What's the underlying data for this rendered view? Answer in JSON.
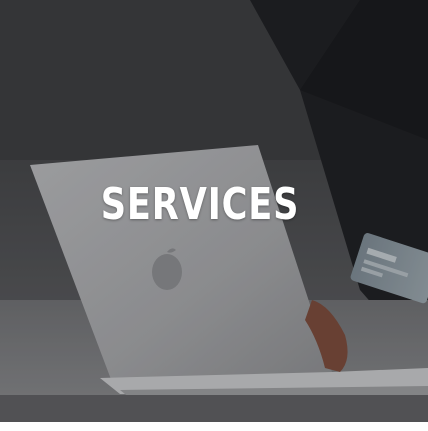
{
  "hero": {
    "title": "SERVICES",
    "image_subject": "laptop-and-credit-card-photo"
  },
  "colors": {
    "title_text": "#ffffff",
    "overlay": "#2b2c30",
    "page_background": "#ffffff"
  }
}
